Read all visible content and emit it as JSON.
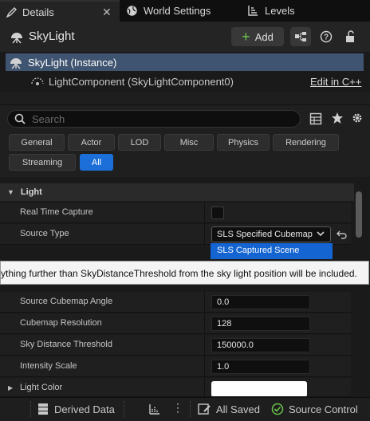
{
  "tabs": [
    {
      "label": "Details"
    },
    {
      "label": "World Settings"
    },
    {
      "label": "Levels"
    }
  ],
  "header": {
    "title": "SkyLight",
    "add_label": "Add"
  },
  "tree": {
    "instance_label": "SkyLight (Instance)",
    "component_label": "LightComponent (SkyLightComponent0)",
    "edit_link": "Edit in C++"
  },
  "search": {
    "placeholder": "Search"
  },
  "filters": [
    "General",
    "Actor",
    "LOD",
    "Misc",
    "Physics",
    "Rendering",
    "Streaming",
    "All"
  ],
  "category": {
    "label": "Light"
  },
  "properties": {
    "real_time_capture": {
      "label": "Real Time Capture",
      "value": false
    },
    "source_type": {
      "label": "Source Type",
      "value": "SLS Specified Cubemap"
    },
    "dropdown_option": "SLS Captured Scene",
    "source_cubemap_angle": {
      "label": "Source Cubemap Angle",
      "value": "0.0"
    },
    "cubemap_resolution": {
      "label": "Cubemap Resolution",
      "value": "128"
    },
    "sky_distance_threshold": {
      "label": "Sky Distance Threshold",
      "value": "150000.0"
    },
    "intensity_scale": {
      "label": "Intensity Scale",
      "value": "1.0"
    },
    "light_color": {
      "label": "Light Color"
    }
  },
  "tooltip": "ything further than SkyDistanceThreshold from the sky light position will be included.",
  "bottom_bar": {
    "derived_data": "Derived Data",
    "all_saved": "All Saved",
    "source_control": "Source Control"
  },
  "colors": {
    "accent": "#1c6fd9",
    "selection": "#3f5470",
    "add_plus": "#6bc34b",
    "source_ok": "#6bc34b"
  }
}
